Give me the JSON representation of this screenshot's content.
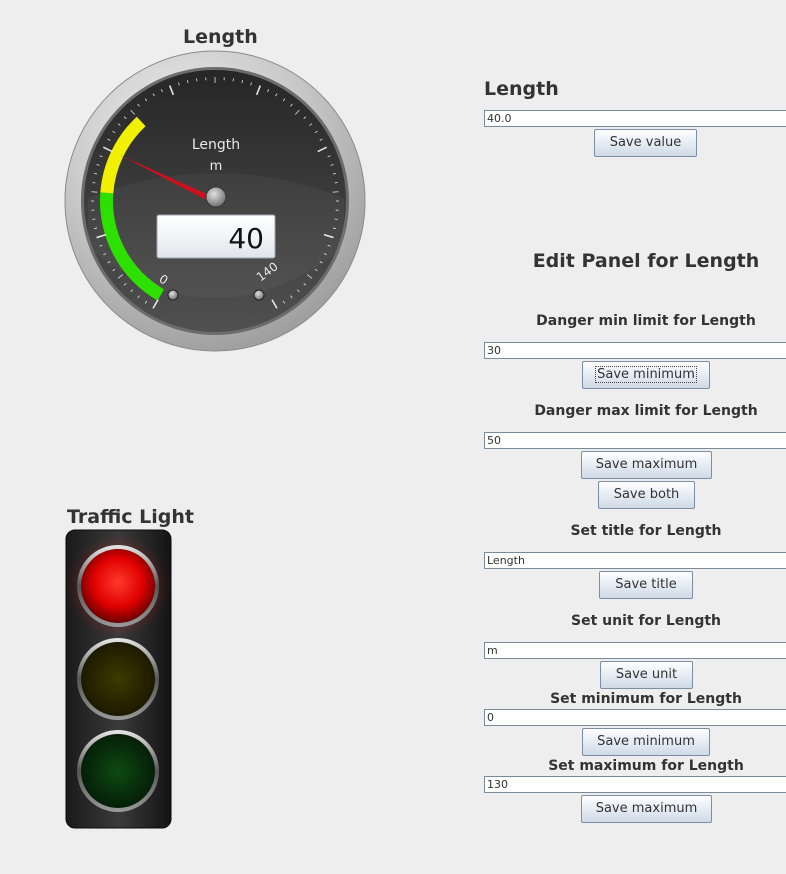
{
  "gauge": {
    "heading": "Length",
    "title": "Length",
    "unit": "m",
    "value": 40,
    "min_label": "0",
    "max_label": "140",
    "colors": {
      "green": "#2ee000",
      "yellow": "#f0f000",
      "needle": "#cc1020"
    }
  },
  "traffic_light": {
    "heading": "Traffic Light",
    "active": "red",
    "colors": {
      "red": "#ff1010",
      "yellow": "#3a3300",
      "green": "#0a3a0a"
    }
  },
  "value_panel": {
    "heading": "Length",
    "value": "40.0",
    "save_label": "Save value"
  },
  "edit_panel": {
    "heading": "Edit Panel for Length",
    "danger_min": {
      "label": "Danger min limit for Length",
      "value": "30",
      "button": "Save minimum"
    },
    "danger_max": {
      "label": "Danger max limit for Length",
      "value": "50",
      "button": "Save maximum"
    },
    "save_both": "Save both",
    "title": {
      "label": "Set title for Length",
      "value": "Length",
      "button": "Save title"
    },
    "unit": {
      "label": "Set unit for Length",
      "value": "m",
      "button": "Save unit"
    },
    "minimum": {
      "label": "Set minimum for Length",
      "value": "0",
      "button": "Save minimum"
    },
    "maximum": {
      "label": "Set maximum for Length",
      "value": "130",
      "button": "Save maximum"
    }
  }
}
